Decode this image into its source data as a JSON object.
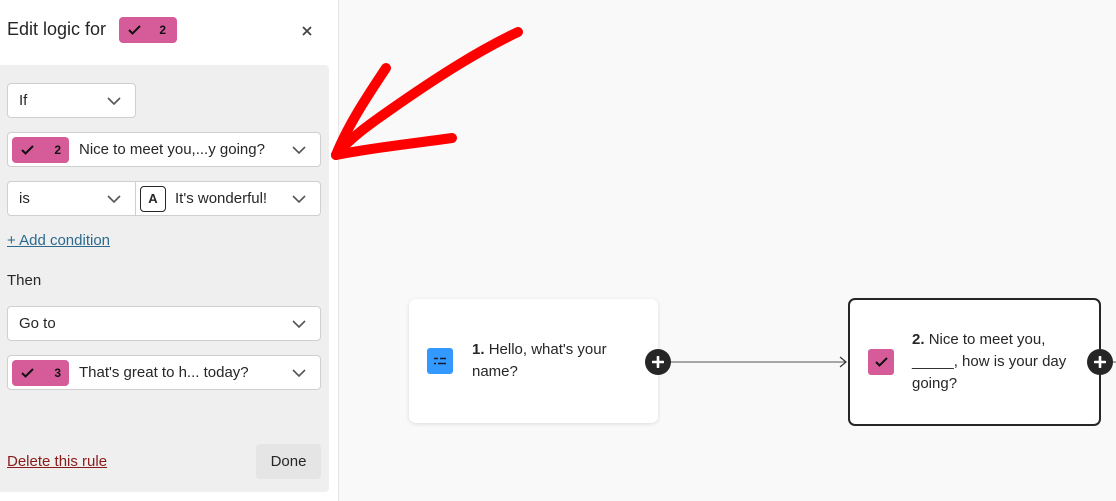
{
  "sidebar": {
    "title": "Edit logic for",
    "header_badge": {
      "number": "2",
      "icon": "checkmark-icon",
      "color": "#d65c99"
    },
    "close_icon": "close-icon",
    "rule": {
      "condition_keyword": "If",
      "question_select": {
        "badge_number": "2",
        "label": "Nice to meet you,...y going?"
      },
      "operator_select": "is",
      "value_select": {
        "type_icon_letter": "A",
        "label": "It's wonderful!"
      },
      "add_condition_label": "+ Add condition",
      "then_label": "Then",
      "action_select": "Go to",
      "target_select": {
        "badge_number": "3",
        "label": "That's great to h... today?"
      }
    },
    "delete_label": "Delete this rule",
    "done_label": "Done"
  },
  "canvas": {
    "nodes": [
      {
        "number": "1.",
        "text": "Hello, what's your name?",
        "icon": "short-text-icon",
        "color": "#3399ff"
      },
      {
        "number": "2.",
        "text": "Nice to meet you, _____, how is your day going?",
        "icon": "checkmark-icon",
        "color": "#d65c99"
      }
    ],
    "annotation_color": "#ff0000"
  }
}
